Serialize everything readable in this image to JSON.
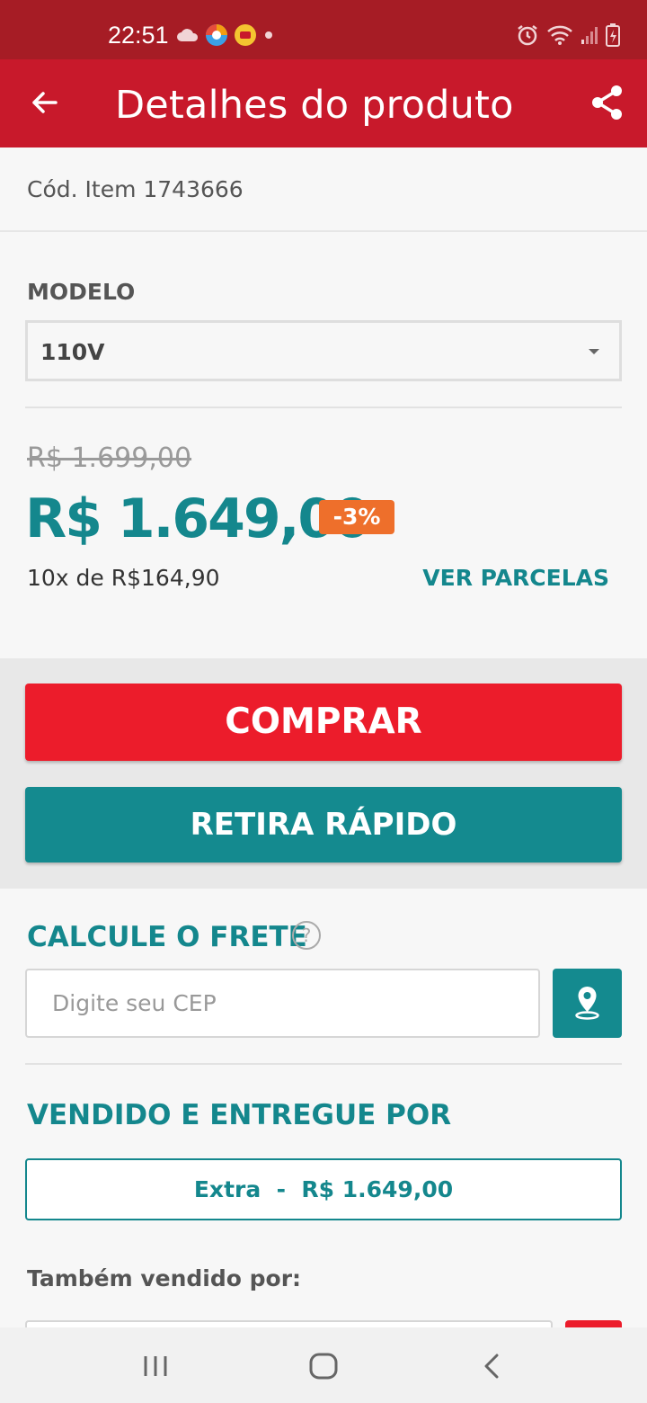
{
  "status_bar": {
    "time": "22:51",
    "icons": [
      "cloud-icon",
      "browser-icon",
      "notification-icon",
      "dot-icon",
      "alarm-icon",
      "wifi-icon",
      "signal-icon",
      "battery-icon"
    ]
  },
  "app_bar": {
    "title": "Detalhes do produto",
    "back_icon": "arrow-left-icon",
    "share_icon": "share-icon"
  },
  "product": {
    "code_text": "Cód. Item 1743666",
    "model_label": "MODELO",
    "model_value": "110V",
    "old_price": "R$ 1.699,00",
    "price": "R$ 1.649,00",
    "discount": "-3%",
    "installments": "10x de R$164,90",
    "ver_parcelas": "VER PARCELAS"
  },
  "actions": {
    "comprar": "COMPRAR",
    "retira_rapido": "RETIRA RÁPIDO"
  },
  "frete": {
    "title": "CALCULE O FRETE",
    "help_glyph": "?",
    "cep_placeholder": "Digite seu CEP",
    "location_icon": "map-pin-icon"
  },
  "seller": {
    "title": "VENDIDO E ENTREGUE POR",
    "main_seller": "Extra  -  R$ 1.649,00",
    "also_sold_by": "Também vendido por:"
  },
  "colors": {
    "status_bar": "#a61c25",
    "app_bar": "#c8192b",
    "teal": "#14878d",
    "red_button": "#ec1c2b",
    "discount_badge": "#ee6f2b"
  },
  "nav_bar": {
    "icons": [
      "recent-apps-icon",
      "home-icon",
      "back-icon"
    ]
  }
}
